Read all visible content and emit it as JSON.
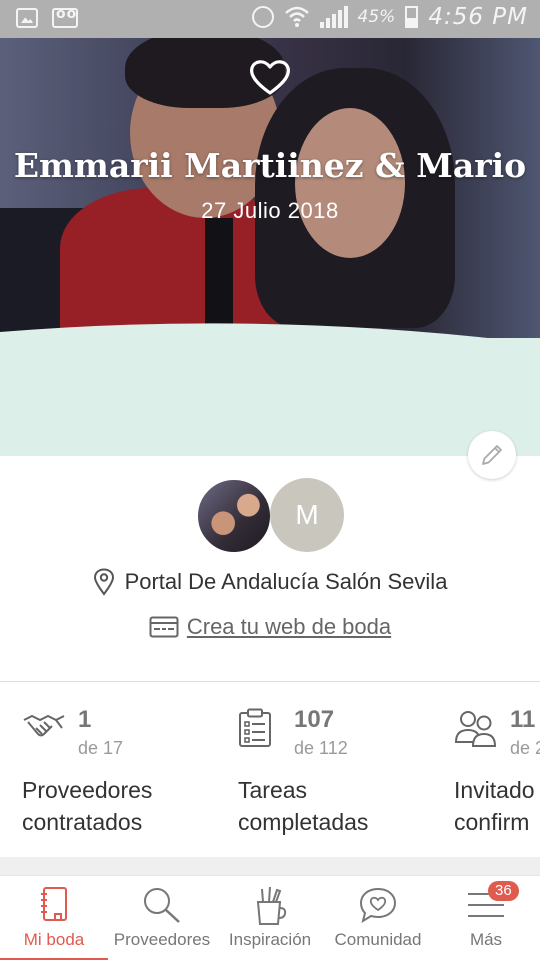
{
  "status_bar": {
    "battery_percent": "45%",
    "time": "4:56 PM",
    "icons": [
      "image-icon",
      "voicemail-icon",
      "alarm-icon",
      "wifi-icon",
      "signal-icon",
      "battery-icon"
    ]
  },
  "hero": {
    "title": "Emmarii Martiinez & Mario",
    "date": "27 Julio 2018",
    "icons": [
      "heart-icon",
      "edit-icon"
    ]
  },
  "couple": {
    "avatar_initial": "M",
    "venue": "Portal De Andalucía Salón Sevila",
    "web_link": "Crea tu web de boda"
  },
  "stats": [
    {
      "value": "1",
      "total": "de 17",
      "label_line1": "Proveedores",
      "label_line2": "contratados",
      "icon": "handshake-icon"
    },
    {
      "value": "107",
      "total": "de 112",
      "label_line1": "Tareas",
      "label_line2": "completadas",
      "icon": "checklist-icon"
    },
    {
      "value": "11",
      "total": "de 2",
      "label_line1": "Invitado",
      "label_line2": "confirm",
      "icon": "guests-icon"
    }
  ],
  "bottom_nav": {
    "items": [
      {
        "label": "Mi boda",
        "icon": "notebook-icon",
        "active": true
      },
      {
        "label": "Proveedores",
        "icon": "search-icon",
        "active": false
      },
      {
        "label": "Inspiración",
        "icon": "inspiration-icon",
        "active": false
      },
      {
        "label": "Comunidad",
        "icon": "chat-heart-icon",
        "active": false
      },
      {
        "label": "Más",
        "icon": "menu-icon",
        "active": false
      }
    ],
    "more_badge": "36"
  },
  "colors": {
    "accent": "#e05a4f",
    "mint": "#dcefe8",
    "status_bar": "#b0b0b0"
  }
}
